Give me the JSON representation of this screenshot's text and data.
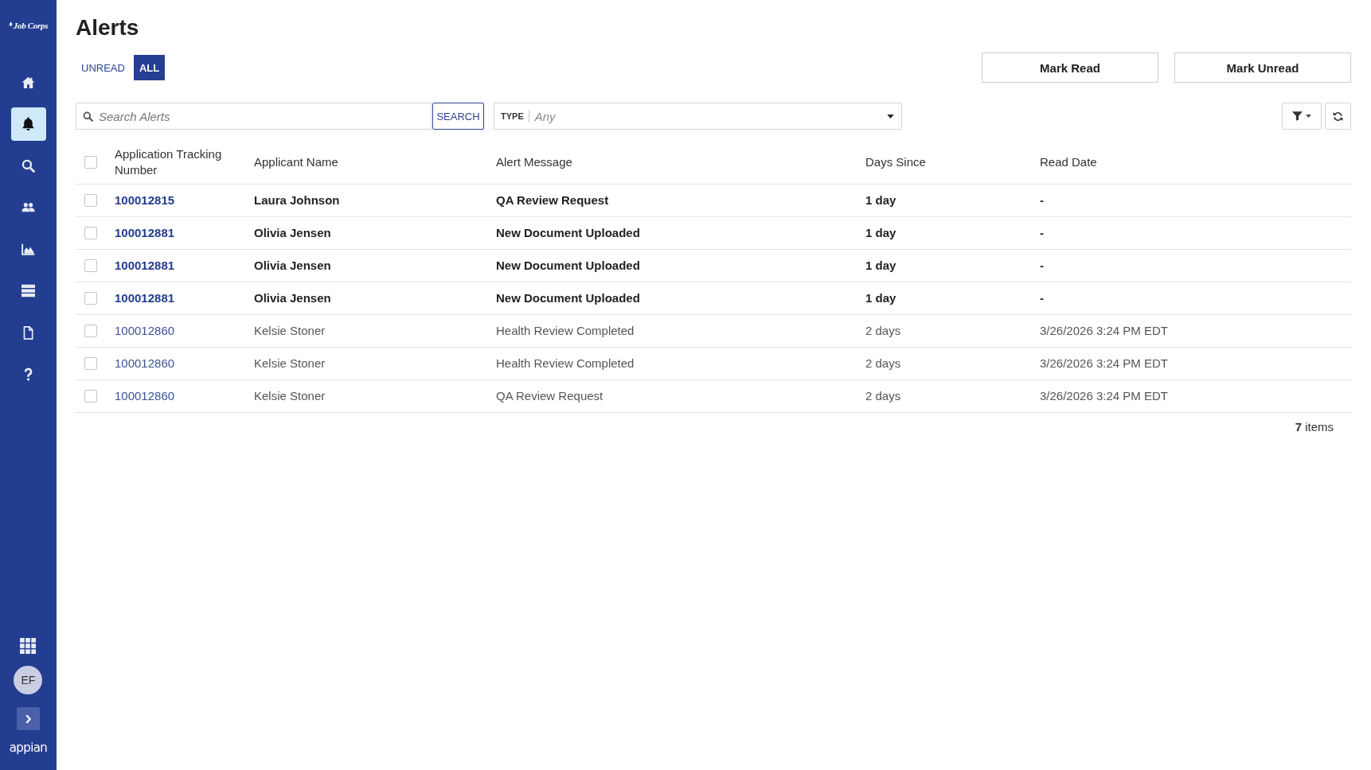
{
  "sidebar": {
    "logo": "Job Corps",
    "nav": [
      {
        "kind": "home",
        "selected": false
      },
      {
        "kind": "alerts",
        "selected": true
      },
      {
        "kind": "search",
        "selected": false
      },
      {
        "kind": "people",
        "selected": false
      },
      {
        "kind": "reports",
        "selected": false
      },
      {
        "kind": "records",
        "selected": false
      },
      {
        "kind": "documents",
        "selected": false
      },
      {
        "kind": "help",
        "selected": false
      }
    ],
    "avatar": "EF",
    "brand": "appian"
  },
  "page": {
    "title": "Alerts"
  },
  "tabs": [
    {
      "label": "UNREAD",
      "selected": false
    },
    {
      "label": "ALL",
      "selected": true
    }
  ],
  "actions": [
    "Mark Read",
    "Mark Unread"
  ],
  "search": {
    "placeholder": "Search Alerts",
    "button": "SEARCH"
  },
  "type_filter": {
    "label": "TYPE",
    "placeholder": "Any"
  },
  "table": {
    "select_all_checked": false,
    "columns": [
      "Application Tracking Number",
      "Applicant Name",
      "Alert Message",
      "Days Since",
      "Read Date"
    ],
    "rows": [
      {
        "checked": false,
        "unread": true,
        "cells": [
          "100012815",
          "Laura Johnson",
          "QA Review Request",
          "1 day",
          "-"
        ]
      },
      {
        "checked": false,
        "unread": true,
        "cells": [
          "100012881",
          "Olivia Jensen",
          "New Document Uploaded",
          "1 day",
          "-"
        ]
      },
      {
        "checked": false,
        "unread": true,
        "cells": [
          "100012881",
          "Olivia Jensen",
          "New Document Uploaded",
          "1 day",
          "-"
        ]
      },
      {
        "checked": false,
        "unread": true,
        "cells": [
          "100012881",
          "Olivia Jensen",
          "New Document Uploaded",
          "1 day",
          "-"
        ]
      },
      {
        "checked": false,
        "unread": false,
        "cells": [
          "100012860",
          "Kelsie Stoner",
          "Health Review Completed",
          "2 days",
          "3/26/2026 3:24 PM EDT"
        ]
      },
      {
        "checked": false,
        "unread": false,
        "cells": [
          "100012860",
          "Kelsie Stoner",
          "Health Review Completed",
          "2 days",
          "3/26/2026 3:24 PM EDT"
        ]
      },
      {
        "checked": false,
        "unread": false,
        "cells": [
          "100012860",
          "Kelsie Stoner",
          "QA Review Request",
          "2 days",
          "3/26/2026 3:24 PM EDT"
        ]
      }
    ]
  },
  "footer": "**7** items"
}
